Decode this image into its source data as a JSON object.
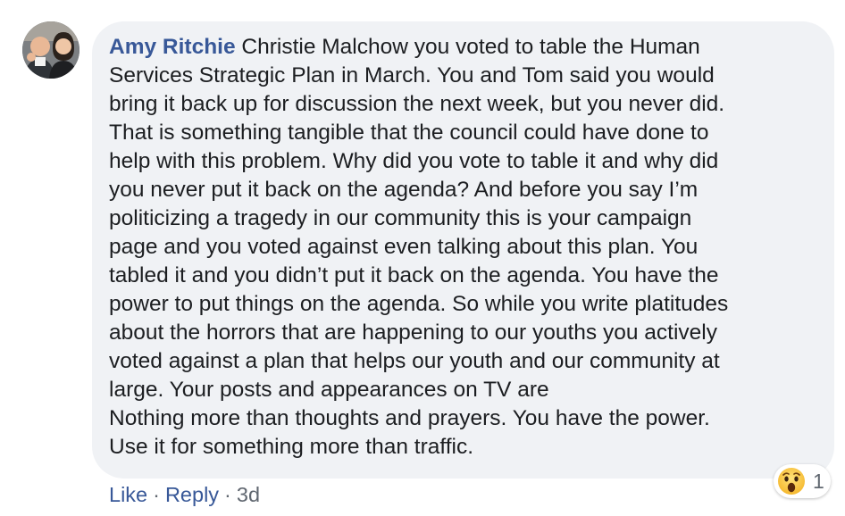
{
  "comment": {
    "author": "Amy Ritchie",
    "body_lines": [
      " Christie Malchow you voted to table the Human",
      "Services Strategic Plan in March. You and Tom said you would",
      "bring it back up for discussion the next week, but you never did.",
      "That is something tangible that the council could have done to",
      "help with this problem. Why did you vote to table it and why did",
      "you never put it back on the agenda? And before you say I’m",
      "politicizing a tragedy in our community this is your campaign",
      "page and you voted against even talking about this plan. You",
      "tabled it and you didn’t put it back on the agenda. You have the",
      "power to put things on the agenda. So while you write platitudes",
      "about the horrors that are happening to our youths you actively",
      "voted against a plan that helps our youth and our community at",
      "large. Your posts and appearances on TV are",
      "Nothing more than thoughts and prayers. You have the power.",
      "Use it for something more than traffic."
    ]
  },
  "actions": {
    "like": "Like",
    "dot1": "·",
    "reply": "Reply",
    "dot2": "·",
    "time": "3d"
  },
  "reactions": {
    "icon": "wow-icon",
    "count": "1"
  },
  "colors": {
    "bubble_bg": "#f0f2f5",
    "author_link": "#385898",
    "meta_text": "#606770",
    "body_text": "#1c1e21"
  }
}
